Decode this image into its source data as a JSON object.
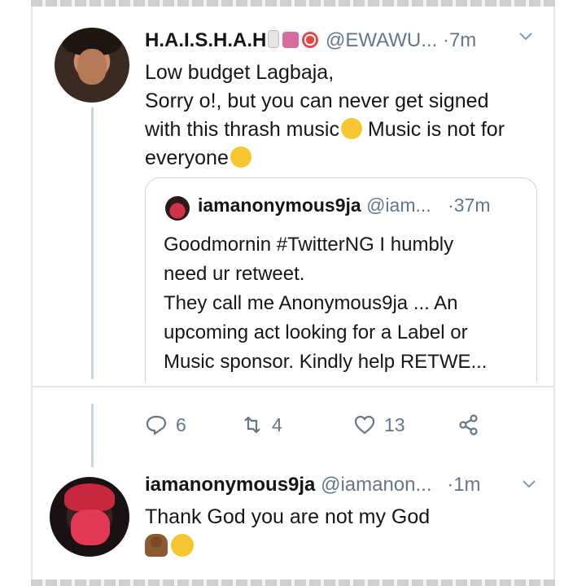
{
  "tweet": {
    "name": "H.A.I.S.H.A.H",
    "handle": "@EWAWU...",
    "separator": "·",
    "time": "7m",
    "lines": [
      "Low budget Lagbaja,",
      "Sorry o!, but you can never get signed",
      "with this thrash music",
      " Music is not for",
      "everyone"
    ]
  },
  "quoted": {
    "name": "iamanonymous9ja",
    "handle": "@iam...",
    "separator": "·",
    "time": "37m",
    "lines": [
      "Goodmornin #TwitterNG I humbly",
      "need ur retweet.",
      "They call me Anonymous9ja ... An",
      "upcoming act looking for a Label or",
      "Music sponsor. Kindly help RETWE..."
    ]
  },
  "actions": {
    "replies": "6",
    "retweets": "4",
    "likes": "13"
  },
  "reply": {
    "name": "iamanonymous9ja",
    "handle": "@iamanon...",
    "separator": "·",
    "time": "1m",
    "text": "Thank God you are not my God"
  },
  "icons": {
    "reply": "reply-icon",
    "retweet": "retweet-icon",
    "like": "heart-icon",
    "share": "share-icon",
    "chevron": "chevron-down-icon"
  },
  "colors": {
    "muted": "#657786",
    "border": "#ccd6dd",
    "text": "#14171a"
  }
}
